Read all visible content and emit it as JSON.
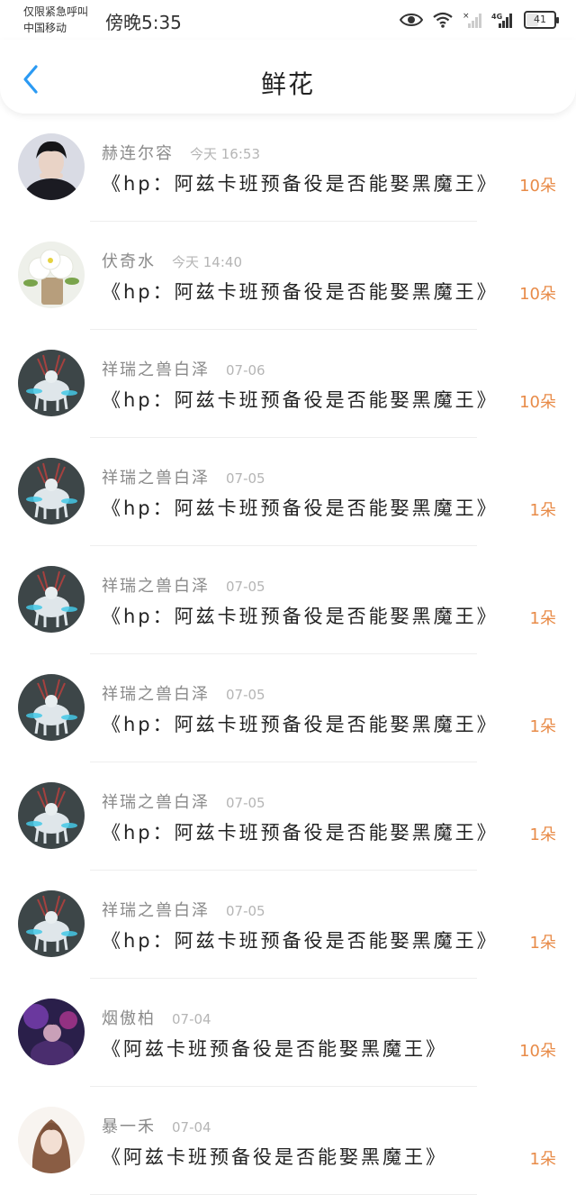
{
  "status_bar": {
    "carrier_line1": "仅限紧急呼叫",
    "carrier_line2": "中国移动",
    "time": "傍晚5:35",
    "network": "4G",
    "battery": "41"
  },
  "header": {
    "title": "鲜花",
    "back_icon": "chevron-left-icon"
  },
  "colors": {
    "back_icon": "#2b9af3",
    "count": "#e88b48",
    "name": "#8a8a8a",
    "time": "#b5b5b5"
  },
  "records": [
    {
      "name": "赫连尔容",
      "time": "今天 16:53",
      "book": "《hp：阿兹卡班预备役是否能娶黑魔王》",
      "count": "10朵"
    },
    {
      "name": "伏奇水",
      "time": "今天 14:40",
      "book": "《hp：阿兹卡班预备役是否能娶黑魔王》",
      "count": "10朵"
    },
    {
      "name": "祥瑞之兽白泽",
      "time": "07-06",
      "book": "《hp：阿兹卡班预备役是否能娶黑魔王》",
      "count": "10朵"
    },
    {
      "name": "祥瑞之兽白泽",
      "time": "07-05",
      "book": "《hp：阿兹卡班预备役是否能娶黑魔王》",
      "count": "1朵"
    },
    {
      "name": "祥瑞之兽白泽",
      "time": "07-05",
      "book": "《hp：阿兹卡班预备役是否能娶黑魔王》",
      "count": "1朵"
    },
    {
      "name": "祥瑞之兽白泽",
      "time": "07-05",
      "book": "《hp：阿兹卡班预备役是否能娶黑魔王》",
      "count": "1朵"
    },
    {
      "name": "祥瑞之兽白泽",
      "time": "07-05",
      "book": "《hp：阿兹卡班预备役是否能娶黑魔王》",
      "count": "1朵"
    },
    {
      "name": "祥瑞之兽白泽",
      "time": "07-05",
      "book": "《hp：阿兹卡班预备役是否能娶黑魔王》",
      "count": "1朵"
    },
    {
      "name": "烟傲柏",
      "time": "07-04",
      "book": "《阿兹卡班预备役是否能娶黑魔王》",
      "count": "10朵"
    },
    {
      "name": "暴一禾",
      "time": "07-04",
      "book": "《阿兹卡班预备役是否能娶黑魔王》",
      "count": "1朵"
    }
  ]
}
